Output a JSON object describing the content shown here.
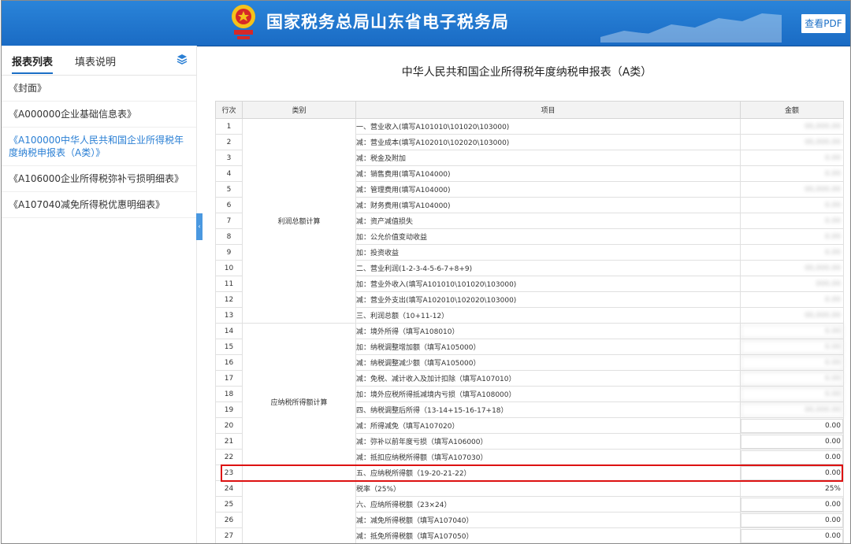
{
  "header": {
    "brand": "国家税务总局山东省电子税务局",
    "pdf_button": "查看PDF"
  },
  "sidebar": {
    "tabs": [
      "报表列表",
      "填表说明"
    ],
    "items": [
      "《封面》",
      "《A000000企业基础信息表》",
      "《A100000中华人民共和国企业所得税年度纳税申报表（A类）》",
      "《A106000企业所得税弥补亏损明细表》",
      "《A107040减免所得税优惠明细表》"
    ]
  },
  "report": {
    "title": "中华人民共和国企业所得税年度纳税申报表（A类）",
    "columns": [
      "行次",
      "类别",
      "项目",
      "金额"
    ],
    "category_profit": "利润总额计算",
    "category_taxable": "应纳税所得额计算",
    "rows": [
      {
        "no": "1",
        "item": "一、营业收入(填写A101010\\101020\\103000)",
        "amount": "00,000.00"
      },
      {
        "no": "2",
        "item": "减：营业成本(填写A102010\\102020\\103000)",
        "amount": "00,000.00"
      },
      {
        "no": "3",
        "item": "减：税金及附加",
        "amount": "0.00"
      },
      {
        "no": "4",
        "item": "减：销售费用(填写A104000)",
        "amount": "0.00"
      },
      {
        "no": "5",
        "item": "减：管理费用(填写A104000)",
        "amount": "00,000.00"
      },
      {
        "no": "6",
        "item": "减：财务费用(填写A104000)",
        "amount": "0.00"
      },
      {
        "no": "7",
        "item": "减：资产减值损失",
        "amount": "0.00"
      },
      {
        "no": "8",
        "item": "加：公允价值变动收益",
        "amount": "0.00"
      },
      {
        "no": "9",
        "item": "加：投资收益",
        "amount": "0.00"
      },
      {
        "no": "10",
        "item": "二、营业利润(1-2-3-4-5-6-7+8+9)",
        "amount": "00,000.00"
      },
      {
        "no": "11",
        "item": "加：营业外收入(填写A101010\\101020\\103000)",
        "amount": "000.00"
      },
      {
        "no": "12",
        "item": "减：营业外支出(填写A102010\\102020\\103000)",
        "amount": "0.00"
      },
      {
        "no": "13",
        "item": "三、利润总额（10+11-12）",
        "amount": "00,000.00"
      },
      {
        "no": "14",
        "item": "减：境外所得（填写A108010）",
        "amount": "0.00"
      },
      {
        "no": "15",
        "item": "加：纳税调整增加额（填写A105000）",
        "amount": "0.00"
      },
      {
        "no": "16",
        "item": "减：纳税调整减少额（填写A105000）",
        "amount": "0.00"
      },
      {
        "no": "17",
        "item": "减：免税、减计收入及加计扣除（填写A107010）",
        "amount": "0.00"
      },
      {
        "no": "18",
        "item": "加：境外应税所得抵减境内亏损（填写A108000）",
        "amount": "0.00"
      },
      {
        "no": "19",
        "item": "四、纳税调整后所得（13-14+15-16-17+18）",
        "amount": "00,000.00"
      },
      {
        "no": "20",
        "item": "减：所得减免（填写A107020）",
        "amount": "0.00"
      },
      {
        "no": "21",
        "item": "减：弥补以前年度亏损（填写A106000）",
        "amount": "0.00"
      },
      {
        "no": "22",
        "item": "减：抵扣应纳税所得额（填写A107030）",
        "amount": "0.00"
      },
      {
        "no": "23",
        "item": "五、应纳税所得额（19-20-21-22）",
        "amount": "0.00"
      },
      {
        "no": "24",
        "item": "税率（25%）",
        "amount": "25%"
      },
      {
        "no": "25",
        "item": "六、应纳所得税额（23×24）",
        "amount": "0.00"
      },
      {
        "no": "26",
        "item": "减：减免所得税额（填写A107040）",
        "amount": "0.00"
      },
      {
        "no": "27",
        "item": "减：抵免所得税额（填写A107050）",
        "amount": "0.00"
      }
    ]
  },
  "colors": {
    "header_blue": "#1a6bc4",
    "accent": "#2a7fd4",
    "highlight": "#dd1111"
  }
}
